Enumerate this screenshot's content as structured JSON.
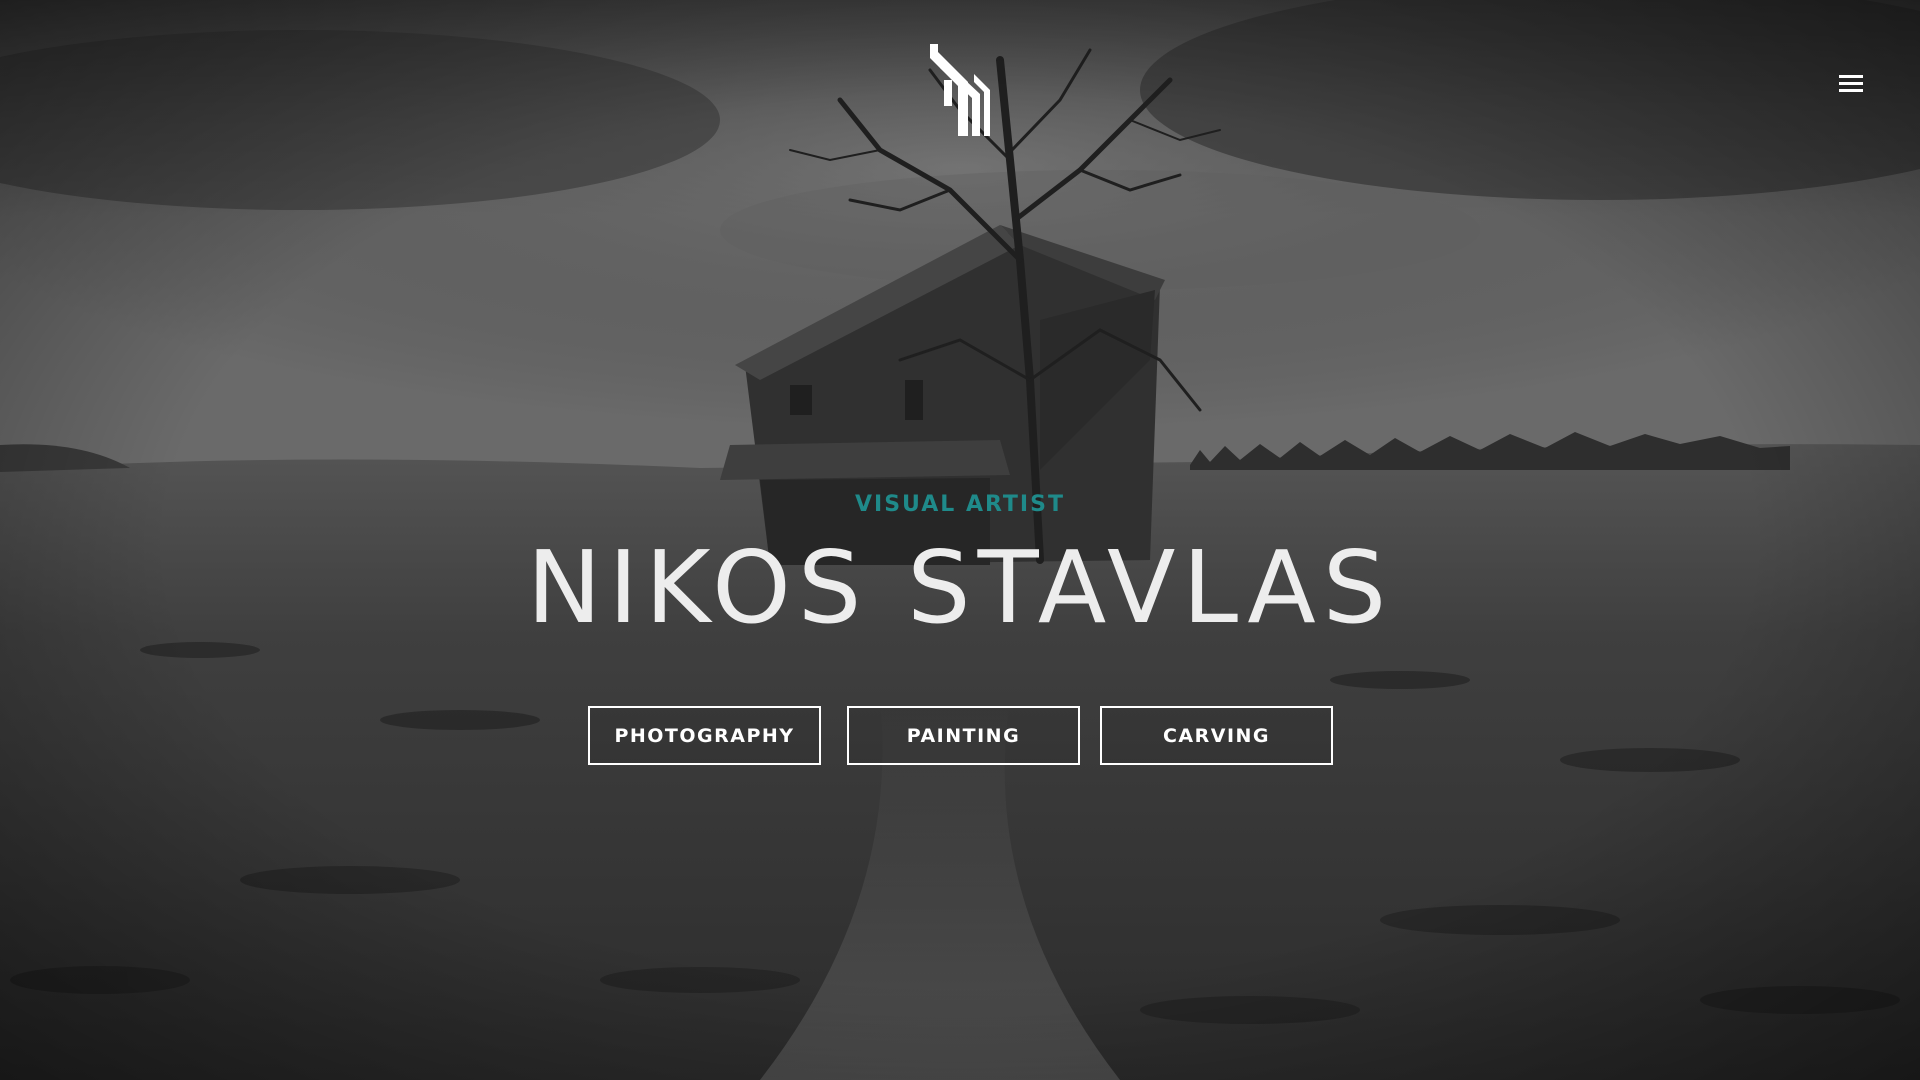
{
  "page": {
    "subtitle": "VISUAL ARTIST",
    "name": "NIKOS STAVLAS",
    "accent_color": "#1f8a8a",
    "text_color": "#ededed"
  },
  "header": {
    "logo_icon": "stacked-chevron-logo-icon",
    "menu_icon": "hamburger-menu-icon"
  },
  "nav_buttons": [
    {
      "label": "PHOTOGRAPHY"
    },
    {
      "label": "PAINTING"
    },
    {
      "label": "CARVING"
    }
  ]
}
